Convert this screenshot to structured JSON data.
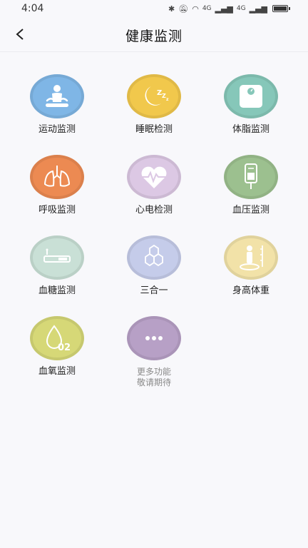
{
  "status": {
    "time": "4:04",
    "net1": "4G",
    "net2": "4G"
  },
  "header": {
    "title": "健康监测"
  },
  "colors": {
    "background": "#f8f8fb",
    "sport": "#7fb6e6",
    "sleep": "#f1c84c",
    "bodyfat": "#86c7b9",
    "breath": "#ec8a52",
    "heart": "#dcc8e4",
    "bp": "#9cc08f",
    "glucose": "#c9e0d6",
    "threeinone": "#c5ccea",
    "height": "#f2e2a8",
    "oxygen": "#d6d877",
    "more": "#b7a0c6"
  },
  "features": [
    {
      "label": "运动监测",
      "icon": "meditation-icon"
    },
    {
      "label": "睡眠检测",
      "icon": "moon-sleep-icon"
    },
    {
      "label": "体脂监测",
      "icon": "scale-icon"
    },
    {
      "label": "呼吸监测",
      "icon": "lungs-icon"
    },
    {
      "label": "心电检测",
      "icon": "heartbeat-icon"
    },
    {
      "label": "血压监测",
      "icon": "iv-bag-icon"
    },
    {
      "label": "血糖监测",
      "icon": "glucose-strip-icon"
    },
    {
      "label": "三合一",
      "icon": "hexagon-molecule-icon"
    },
    {
      "label": "身高体重",
      "icon": "height-measure-icon"
    },
    {
      "label": "血氧监测",
      "icon": "oxygen-drop-icon"
    },
    {
      "label_line1": "更多功能",
      "label_line2": "敬请期待",
      "icon": "more-dots-icon"
    }
  ],
  "oxygen_badge": "02"
}
